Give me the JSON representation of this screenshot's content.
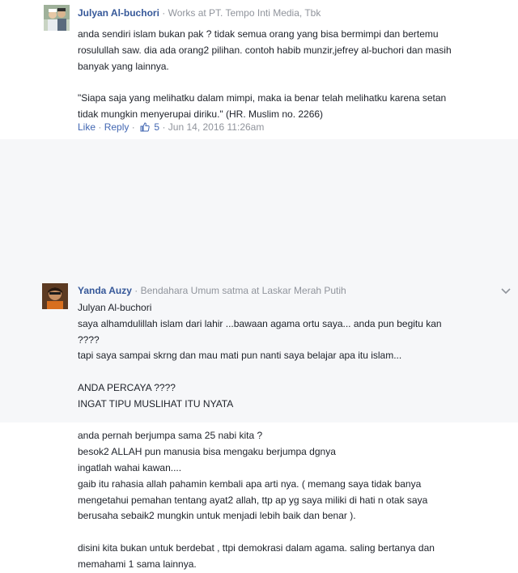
{
  "comments": [
    {
      "author": "Julyan Al-buchori",
      "separator": "·",
      "role": "Works at PT. Tempo Inti Media, Tbk",
      "lines": [
        "anda sendiri islam bukan pak ? tidak semua orang yang bisa bermimpi dan bertemu",
        "rosulullah saw. dia ada orang2 pilihan. contoh habib munzir,jefrey al-buchori dan masih",
        "banyak yang lainnya.",
        "",
        "\"Siapa saja yang melihatku dalam mimpi, maka ia benar telah melihatku karena setan",
        "tidak mungkin menyerupai diriku.\" (HR. Muslim no. 2266)"
      ],
      "actions": {
        "like": "Like",
        "dot1": "·",
        "reply": "Reply",
        "dot2": "·",
        "like_count": "5",
        "dot3": "·",
        "timestamp": "Jun 14, 2016 11:26am"
      }
    },
    {
      "author": "Yanda Auzy",
      "separator": "·",
      "role": "Bendahara Umum satma at Laskar Merah Putih",
      "lines": [
        "Julyan Al-buchori",
        "saya alhamdulillah islam dari lahir ...bawaan agama ortu saya... anda pun begitu kan",
        "????",
        "tapi saya sampai skrng dan mau mati pun nanti saya belajar apa itu islam...",
        "",
        "ANDA PERCAYA ????",
        "INGAT TIPU MUSLIHAT ITU NYATA",
        "",
        "anda pernah berjumpa sama 25 nabi kita ?",
        "besok2 ALLAH pun manusia bisa mengaku berjumpa dgnya",
        "ingatlah wahai kawan....",
        "gaib itu rahasia allah pahamin kembali apa arti nya. ( memang saya tidak banya",
        "mengetahui pemahan tentang ayat2 allah, ttp ap yg saya miliki di hati n otak saya",
        "berusaha sebaik2 mungkin untuk menjadi lebih baik dan benar ).",
        "",
        "disini kita bukan untuk berdebat , ttpi demokrasi dalam agama. saling bertanya dan",
        "memahami 1 sama lainnya."
      ]
    }
  ],
  "colors": {
    "link": "#365899",
    "meta": "#90949c",
    "action_link": "#4267b2",
    "highlight_bg": "#f6f7f9"
  },
  "icons": {
    "like": "thumbs-up-icon",
    "options": "chevron-down-icon"
  }
}
